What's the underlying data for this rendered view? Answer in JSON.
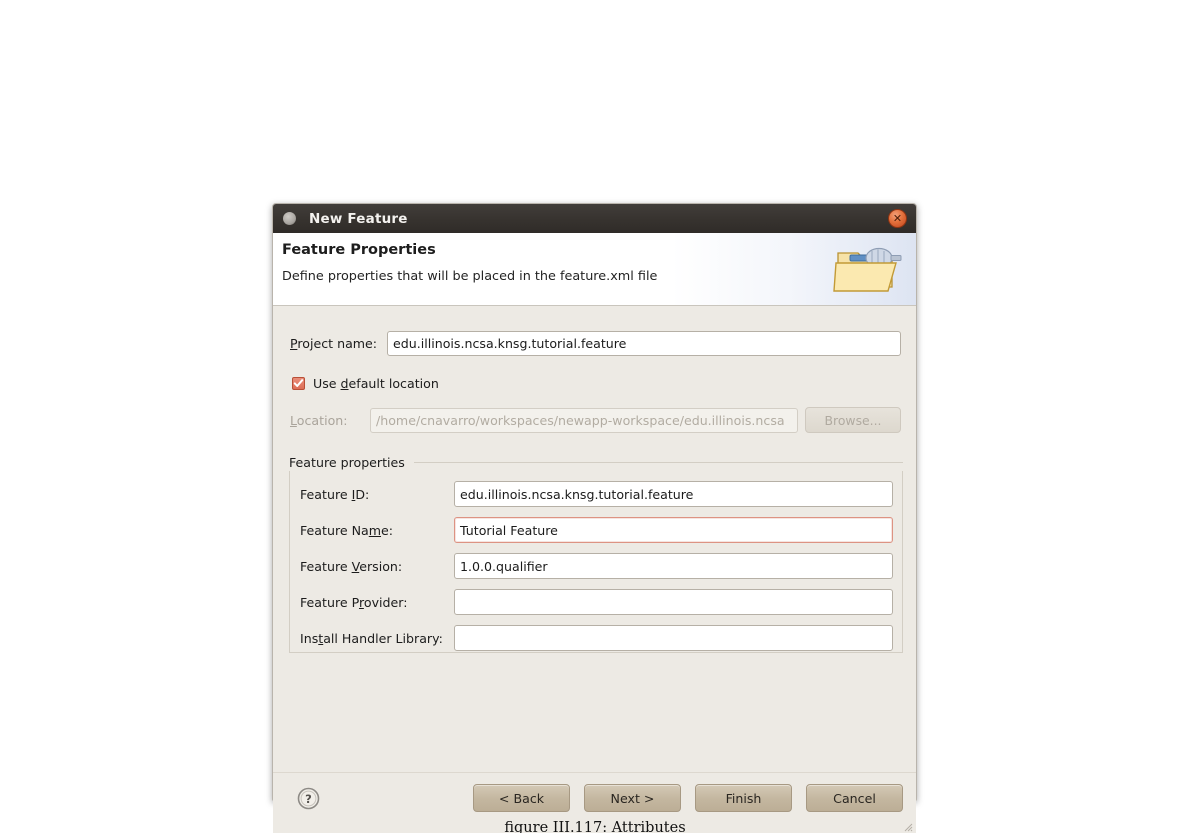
{
  "window": {
    "title": "New Feature",
    "title_icon": "dot-icon",
    "close_label": "✕"
  },
  "header": {
    "title": "Feature Properties",
    "subtitle": "Define properties that will be placed in the feature.xml file",
    "icon": "folder-plugin-icon"
  },
  "form": {
    "project_name": {
      "label": "Project name:",
      "value": "edu.illinois.ncsa.knsg.tutorial.feature",
      "placeholder": ""
    },
    "use_default_location": {
      "label": "Use default location",
      "checked": true
    },
    "location": {
      "label": "Location:",
      "value": "/home/cnavarro/workspaces/newapp-workspace/edu.illinois.ncsa",
      "enabled": false
    },
    "browse_button": "Browse..."
  },
  "group": {
    "title": "Feature properties",
    "fields": [
      {
        "label": "Feature ID:",
        "value": "edu.illinois.ncsa.knsg.tutorial.feature",
        "focused": false
      },
      {
        "label": "Feature Name:",
        "value": "Tutorial Feature",
        "focused": true
      },
      {
        "label": "Feature Version:",
        "value": "1.0.0.qualifier",
        "focused": false
      },
      {
        "label": "Feature Provider:",
        "value": "",
        "focused": false
      },
      {
        "label": "Install Handler Library:",
        "value": "",
        "focused": false
      }
    ]
  },
  "footer": {
    "help_icon": "help-circle-icon",
    "buttons": [
      {
        "label": "< Back"
      },
      {
        "label": "Next >"
      },
      {
        "label": "Finish"
      },
      {
        "label": "Cancel"
      }
    ]
  },
  "caption": "figure III.117:  Attributes",
  "colors": {
    "titlebar": "#37332f",
    "dialog_bg": "#edeae4",
    "close_button": "#e3703b",
    "checkbox": "#dd6f57",
    "focus_border": "#dd9383",
    "button": "#c4b7a0"
  }
}
